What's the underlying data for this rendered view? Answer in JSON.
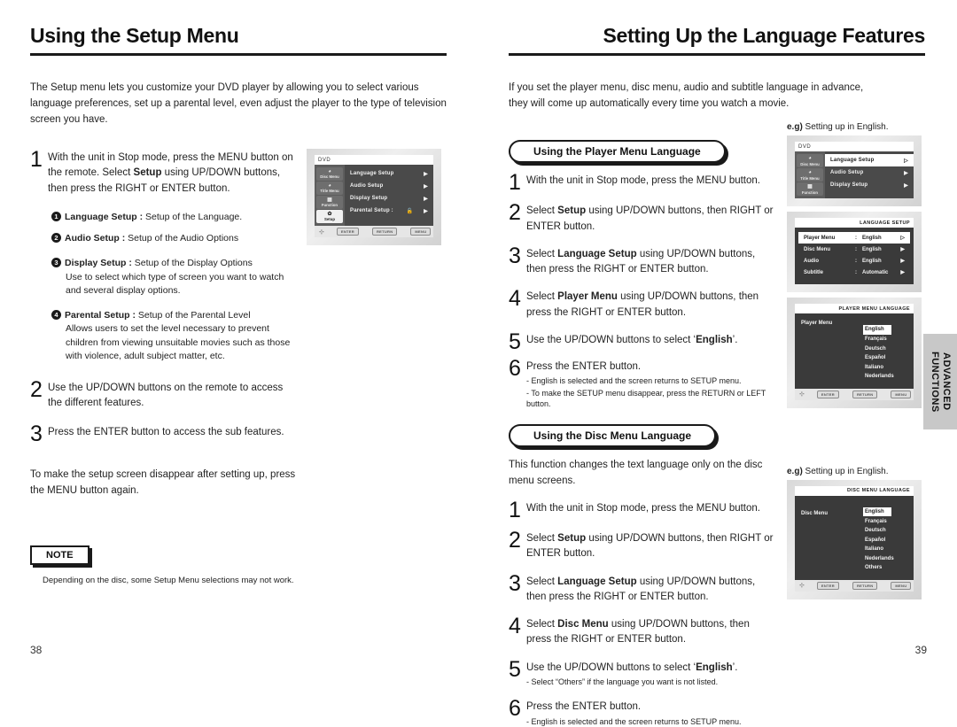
{
  "left_page": {
    "title": "Using the Setup Menu",
    "intro": "The Setup menu lets you customize your DVD player by allowing you to select various language preferences, set up a parental level, even adjust the player to the type of television screen you have.",
    "steps": [
      {
        "num": "1",
        "text": "With the unit in Stop mode, press the MENU button on the remote. Select ",
        "bold": "Setup",
        "text2": " using UP/DOWN buttons, then press the RIGHT or ENTER button."
      },
      {
        "num": "2",
        "text": "Use the UP/DOWN buttons on the remote to access the different features.",
        "bold": "",
        "text2": ""
      },
      {
        "num": "3",
        "text": "Press the ENTER button to access the sub features.",
        "bold": "",
        "text2": ""
      }
    ],
    "bullets": [
      {
        "num": "1",
        "label": "Language Setup :",
        "desc": " Setup of the Language.",
        "sub": ""
      },
      {
        "num": "2",
        "label": "Audio Setup :",
        "desc": " Setup of the Audio Options",
        "sub": ""
      },
      {
        "num": "3",
        "label": "Display Setup :",
        "desc": " Setup of the Display Options",
        "sub": "Use to select which type of screen you want to watch and several display options."
      },
      {
        "num": "4",
        "label": "Parental Setup :",
        "desc": " Setup of the Parental Level",
        "sub": "Allows users to set the level necessary to prevent children from viewing unsuitable movies such as those with violence, adult subject matter, etc."
      }
    ],
    "closing": "To make the setup screen disappear after setting up, press the MENU button again.",
    "note_label": "NOTE",
    "note_text": "Depending on the disc, some Setup Menu selections may not work.",
    "folio": "38"
  },
  "right_page": {
    "title": "Setting Up the Language Features",
    "intro": "If you set the player menu, disc menu, audio and subtitle language in advance, they will come up automatically every time you watch a movie.",
    "section1": {
      "heading": "Using the Player Menu Language",
      "steps": [
        {
          "num": "1",
          "text": "With the unit in Stop mode, press the MENU button.",
          "bold": "",
          "text2": "",
          "sub": []
        },
        {
          "num": "2",
          "text": "Select ",
          "bold": "Setup",
          "text2": " using UP/DOWN buttons, then RIGHT or ENTER button.",
          "sub": []
        },
        {
          "num": "3",
          "text": "Select ",
          "bold": "Language Setup",
          "text2": " using UP/DOWN buttons, then press the RIGHT or ENTER button.",
          "sub": []
        },
        {
          "num": "4",
          "text": "Select ",
          "bold": "Player Menu",
          "text2": " using UP/DOWN buttons, then press the RIGHT or ENTER button.",
          "sub": []
        },
        {
          "num": "5",
          "text": "Use the UP/DOWN buttons to select ‘",
          "bold": "English",
          "text2": "’.",
          "sub": []
        },
        {
          "num": "6",
          "text": "Press the ENTER button.",
          "bold": "",
          "text2": "",
          "sub": [
            "- English is selected and the screen returns to SETUP menu.",
            "- To make the SETUP menu disappear, press the RETURN or LEFT button."
          ]
        }
      ]
    },
    "section2": {
      "heading": "Using the Disc Menu Language",
      "lead": "This function changes the text language only on the disc menu screens.",
      "steps": [
        {
          "num": "1",
          "text": "With the unit in Stop mode, press the MENU button.",
          "bold": "",
          "text2": "",
          "sub": []
        },
        {
          "num": "2",
          "text": "Select ",
          "bold": "Setup",
          "text2": " using UP/DOWN buttons, then RIGHT or ENTER button.",
          "sub": []
        },
        {
          "num": "3",
          "text": "Select ",
          "bold": "Language Setup",
          "text2": " using UP/DOWN buttons, then press the RIGHT or ENTER button.",
          "sub": []
        },
        {
          "num": "4",
          "text": "Select ",
          "bold": "Disc Menu",
          "text2": " using UP/DOWN buttons, then press the RIGHT or ENTER button.",
          "sub": []
        },
        {
          "num": "5",
          "text": "Use the UP/DOWN buttons to select ‘",
          "bold": "English",
          "text2": "’.",
          "sub": [
            "- Select “Others” if the language you want is not listed."
          ]
        },
        {
          "num": "6",
          "text": "Press the ENTER button.",
          "bold": "",
          "text2": "",
          "sub": [
            "- English is selected and the screen returns to SETUP menu."
          ]
        }
      ]
    },
    "eg_label_bold": "e.g)",
    "eg_label_rest": " Setting up in English.",
    "side_tab": "ADVANCED\nFUNCTIONS",
    "side_tab_line1": "ADVANCED",
    "side_tab_line2": "FUNCTIONS",
    "folio": "39"
  },
  "tv_screens": {
    "setup_menu": {
      "titlebar": "DVD",
      "titlebar_right": "",
      "sidebar": [
        {
          "icon": "◕",
          "label": "Disc Menu",
          "active": false
        },
        {
          "icon": "◕",
          "label": "Title Menu",
          "active": false
        },
        {
          "icon": "▦",
          "label": "Function",
          "active": false
        },
        {
          "icon": "✿",
          "label": "Setup",
          "active": true
        }
      ],
      "rows": [
        {
          "label": "Language Setup",
          "value": "",
          "arrow": "▶",
          "selected": false
        },
        {
          "label": "Audio Setup",
          "value": "",
          "arrow": "▶",
          "selected": false
        },
        {
          "label": "Display Setup",
          "value": "",
          "arrow": "▶",
          "selected": false
        },
        {
          "label": "Parental Setup :",
          "value": "🔓",
          "arrow": "▶",
          "selected": false
        }
      ],
      "buttons": [
        "ENTER",
        "RETURN",
        "MENU"
      ]
    },
    "setup_menu_sel": {
      "titlebar": "DVD",
      "sidebar": [
        {
          "icon": "◕",
          "label": "Disc Menu",
          "active": false
        },
        {
          "icon": "◕",
          "label": "Title Menu",
          "active": false
        },
        {
          "icon": "▦",
          "label": "Function",
          "active": false
        }
      ],
      "rows": [
        {
          "label": "Language Setup",
          "arrow": "▷",
          "selected": true
        },
        {
          "label": "Audio Setup",
          "arrow": "▶",
          "selected": false
        },
        {
          "label": "Display Setup",
          "arrow": "▶",
          "selected": false
        }
      ]
    },
    "language_setup": {
      "titlebar_right": "LANGUAGE SETUP",
      "rows": [
        {
          "name": "Player Menu",
          "value": "English",
          "arrow": "▷",
          "selected": true
        },
        {
          "name": "Disc Menu",
          "value": "English",
          "arrow": "▶",
          "selected": false
        },
        {
          "name": "Audio",
          "value": "English",
          "arrow": "▶",
          "selected": false
        },
        {
          "name": "Subtitle",
          "value": "Automatic",
          "arrow": "▶",
          "selected": false
        }
      ]
    },
    "player_menu_language": {
      "titlebar_right": "PLAYER MENU LANGUAGE",
      "left_label": "Player Menu",
      "options": [
        "English",
        "Français",
        "Deutsch",
        "Español",
        "Italiano",
        "Nederlands"
      ],
      "selected": "English",
      "buttons": [
        "ENTER",
        "RETURN",
        "MENU"
      ]
    },
    "disc_menu_language": {
      "titlebar_right": "DISC MENU LANGUAGE",
      "left_label": "Disc Menu",
      "options": [
        "English",
        "Français",
        "Deutsch",
        "Español",
        "Italiano",
        "Nederlands",
        "Others"
      ],
      "selected": "English",
      "buttons": [
        "ENTER",
        "RETURN",
        "MENU"
      ]
    }
  }
}
